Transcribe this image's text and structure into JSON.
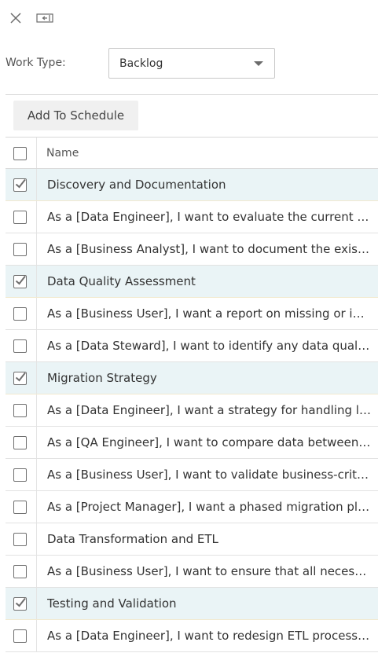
{
  "toolbar": {
    "close_icon": "close-icon",
    "collapse_icon": "collapse-panel-icon"
  },
  "work_type": {
    "label": "Work Type:",
    "selected": "Backlog"
  },
  "add_to_schedule_label": "Add To Schedule",
  "grid": {
    "header_name": "Name",
    "header_checked": false,
    "rows": [
      {
        "text": "Discovery and Documentation",
        "checked": true,
        "parent": true
      },
      {
        "text": "As a [Data Engineer], I want to evaluate the current data model and schema",
        "checked": false,
        "parent": false
      },
      {
        "text": "As a [Business Analyst], I want to document the existing processes",
        "checked": false,
        "parent": false
      },
      {
        "text": "Data Quality Assessment",
        "checked": true,
        "parent": true
      },
      {
        "text": "As a [Business User], I want a report on missing or inconsistent data",
        "checked": false,
        "parent": false
      },
      {
        "text": "As a [Data Steward], I want to identify any data quality issues",
        "checked": false,
        "parent": false
      },
      {
        "text": "Migration Strategy",
        "checked": true,
        "parent": true
      },
      {
        "text": "As a [Data Engineer], I want a strategy for handling large data volumes",
        "checked": false,
        "parent": false
      },
      {
        "text": "As a [QA Engineer], I want to compare data between source and target",
        "checked": false,
        "parent": false
      },
      {
        "text": "As a [Business User], I want to validate business-critical reports",
        "checked": false,
        "parent": false
      },
      {
        "text": "As a [Project Manager], I want a phased migration plan",
        "checked": false,
        "parent": false
      },
      {
        "text": "Data Transformation and ETL",
        "checked": false,
        "parent": false
      },
      {
        "text": "As a [Business User], I want to ensure that all necessary data is migrated",
        "checked": false,
        "parent": false
      },
      {
        "text": "Testing and Validation",
        "checked": true,
        "parent": true
      },
      {
        "text": "As a [Data Engineer], I want to redesign ETL processes for the new platform",
        "checked": false,
        "parent": false
      }
    ]
  }
}
